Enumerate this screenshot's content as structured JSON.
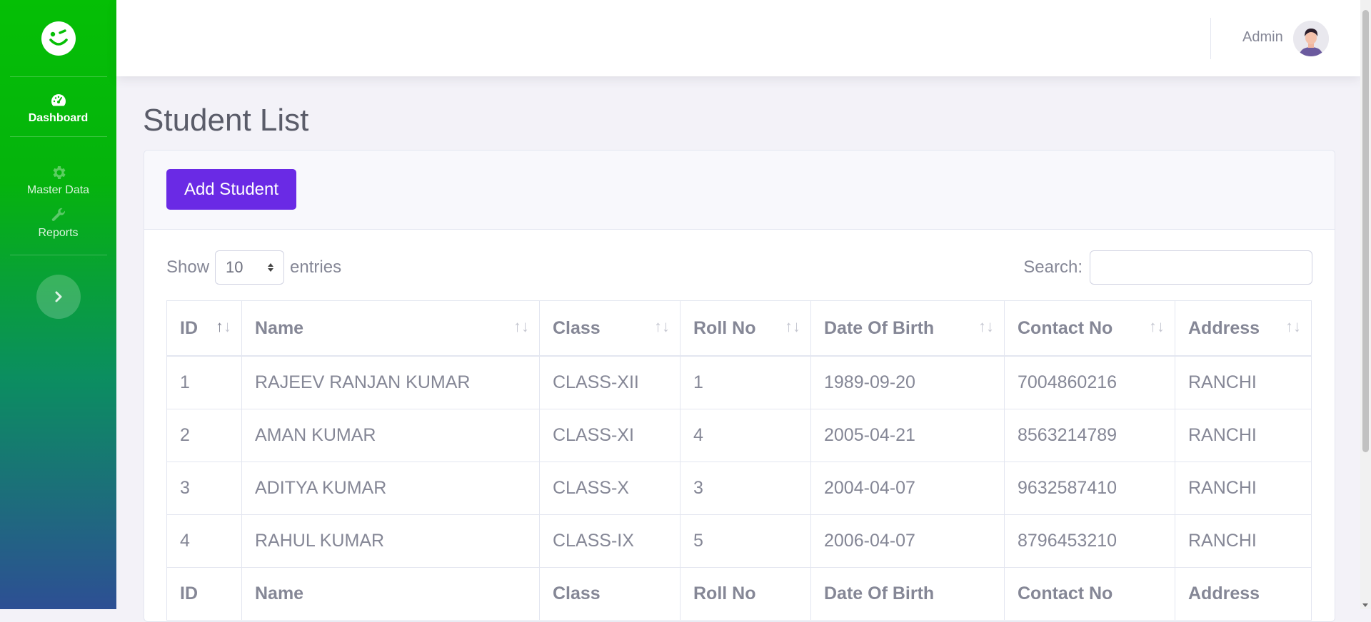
{
  "sidebar": {
    "items": [
      {
        "label": "Dashboard",
        "icon": "tachometer-icon"
      },
      {
        "label": "Master Data",
        "icon": "gear-icon"
      },
      {
        "label": "Reports",
        "icon": "wrench-icon"
      }
    ],
    "colors": {
      "top": "#05bf05",
      "bottom": "#2d4f94"
    }
  },
  "topbar": {
    "user_name": "Admin"
  },
  "page": {
    "title": "Student List"
  },
  "card": {
    "add_button": "Add Student"
  },
  "datatable": {
    "show_label": "Show",
    "page_length": "10",
    "entries_label": "entries",
    "search_label": "Search:",
    "search_value": "",
    "columns": [
      "ID",
      "Name",
      "Class",
      "Roll No",
      "Date Of Birth",
      "Contact No",
      "Address"
    ],
    "rows": [
      [
        "1",
        "RAJEEV RANJAN KUMAR",
        "CLASS-XII",
        "1",
        "1989-09-20",
        "7004860216",
        "RANCHI"
      ],
      [
        "2",
        "AMAN KUMAR",
        "CLASS-XI",
        "4",
        "2005-04-21",
        "8563214789",
        "RANCHI"
      ],
      [
        "3",
        "ADITYA KUMAR",
        "CLASS-X",
        "3",
        "2004-04-07",
        "9632587410",
        "RANCHI"
      ],
      [
        "4",
        "RAHUL KUMAR",
        "CLASS-IX",
        "5",
        "2006-04-07",
        "8796453210",
        "RANCHI"
      ]
    ],
    "sorted_column": "ID"
  },
  "accent_color": "#6a2ae5"
}
